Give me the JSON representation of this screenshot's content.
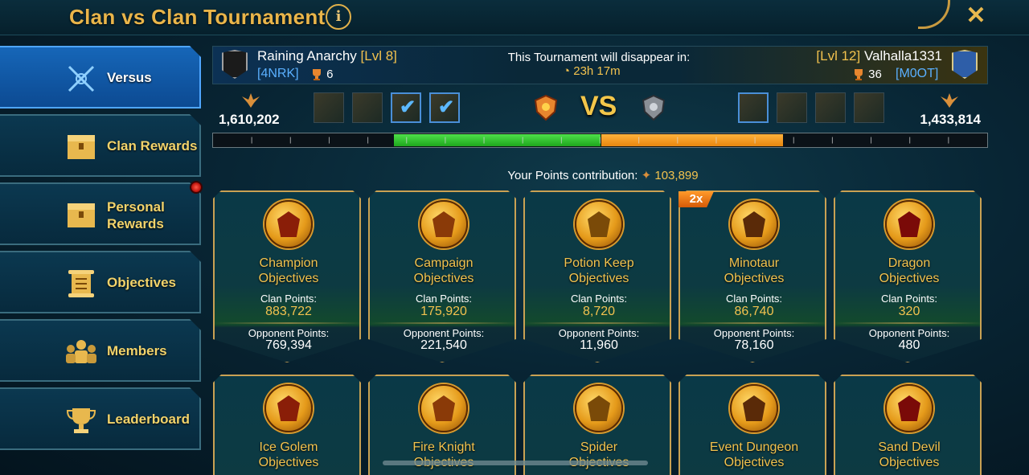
{
  "title": "Clan vs Clan Tournament",
  "sidebar": {
    "items": [
      {
        "label": "Versus",
        "icon": "crossed-swords-icon",
        "active": true
      },
      {
        "label": "Clan Rewards",
        "icon": "chest-icon"
      },
      {
        "label": "Personal Rewards",
        "icon": "chest-icon",
        "notification": true
      },
      {
        "label": "Objectives",
        "icon": "scroll-icon"
      },
      {
        "label": "Members",
        "icon": "members-icon"
      },
      {
        "label": "Leaderboard",
        "icon": "trophy-icon"
      }
    ]
  },
  "header": {
    "left_clan": {
      "name": "Raining Anarchy",
      "level": "[Lvl 8]",
      "tag": "[4NRK]",
      "trophies": "6"
    },
    "disappear_text": "This Tournament will disappear in:",
    "timer": "23h 17m",
    "right_clan": {
      "name": "Valhalla1331",
      "level": "[Lvl 12]",
      "tag": "[M0OT]",
      "trophies": "36"
    }
  },
  "versus": {
    "left_score": "1,610,202",
    "right_score": "1,433,814",
    "vs": "VS",
    "left_progress": 0.267,
    "right_progress": 0.235
  },
  "contribution": {
    "label": "Your Points contribution:",
    "value": "103,899"
  },
  "cards": [
    {
      "title_line1": "Champion",
      "title_line2": "Objectives",
      "clan_label": "Clan Points:",
      "clan_points": "883,722",
      "opp_label": "Opponent Points:",
      "opp_points": "769,394"
    },
    {
      "title_line1": "Campaign",
      "title_line2": "Objectives",
      "clan_label": "Clan Points:",
      "clan_points": "175,920",
      "opp_label": "Opponent Points:",
      "opp_points": "221,540"
    },
    {
      "title_line1": "Potion Keep",
      "title_line2": "Objectives",
      "clan_label": "Clan Points:",
      "clan_points": "8,720",
      "opp_label": "Opponent Points:",
      "opp_points": "11,960"
    },
    {
      "title_line1": "Minotaur",
      "title_line2": "Objectives",
      "clan_label": "Clan Points:",
      "clan_points": "86,740",
      "opp_label": "Opponent Points:",
      "opp_points": "78,160",
      "badge": "2x"
    },
    {
      "title_line1": "Dragon",
      "title_line2": "Objectives",
      "clan_label": "Clan Points:",
      "clan_points": "320",
      "opp_label": "Opponent Points:",
      "opp_points": "480"
    }
  ],
  "cards_row2": [
    {
      "title_line1": "Ice Golem",
      "title_line2": "Objectives"
    },
    {
      "title_line1": "Fire Knight",
      "title_line2": "Objectives"
    },
    {
      "title_line1": "Spider",
      "title_line2": "Objectives"
    },
    {
      "title_line1": "Event Dungeon",
      "title_line2": "Objectives"
    },
    {
      "title_line1": "Sand Devil",
      "title_line2": "Objectives"
    }
  ],
  "colors": {
    "accent_gold": "#f2c24e",
    "active_blue": "#1666b8",
    "tag_blue": "#5ab0ff",
    "progress_green": "#2ec42a",
    "progress_orange": "#f39a1e"
  }
}
